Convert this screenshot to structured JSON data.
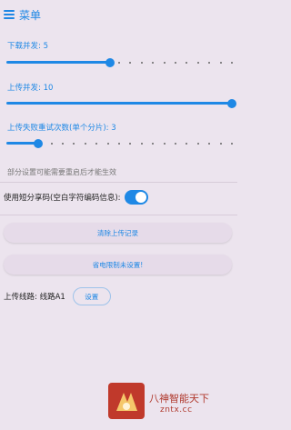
{
  "header": {
    "title": "菜单",
    "icon": "menu-icon"
  },
  "sliders": [
    {
      "label": "下载并发: 5",
      "fraction": 0.46,
      "ticks": 20
    },
    {
      "label": "上传并发: 10",
      "fraction": 1.0,
      "ticks": 20
    },
    {
      "label": "上传失败重试次数(单个分片): 3",
      "fraction": 0.14,
      "ticks": 20
    }
  ],
  "note": "部分设置可能需要重启后才能生效",
  "short_share": {
    "label": "使用短分享码(空白字符编码信息):",
    "enabled": true
  },
  "buttons": {
    "clear_upload": "清除上传记录",
    "power_limit": "省电限制未设置!"
  },
  "route": {
    "label": "上传线路: 线路A1",
    "button": "设置"
  },
  "watermark": {
    "brand": "八神智能天下",
    "site": "zntx.cc"
  },
  "colors": {
    "accent": "#1e88e5",
    "background": "#ece4ee",
    "button_bg": "#e6dbe9"
  }
}
